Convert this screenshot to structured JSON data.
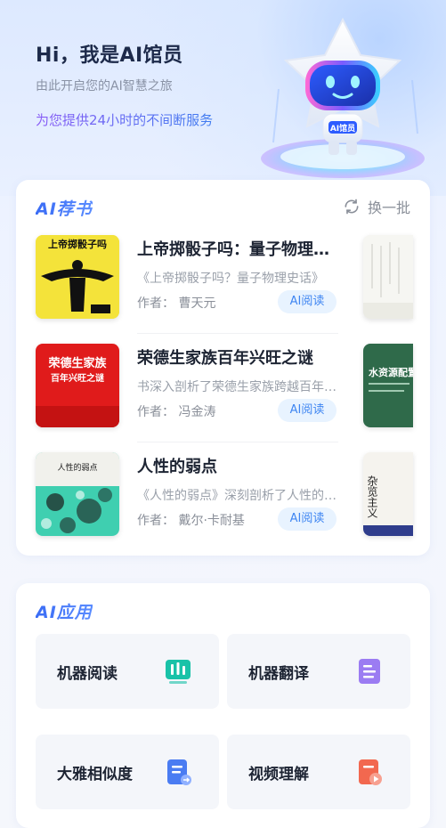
{
  "header": {
    "greeting": "Hi，我是AI馆员",
    "subtitle": "由此开启您的AI智慧之旅",
    "service": "为您提供24小时的不间断服务",
    "mascot_badge": "AI馆员"
  },
  "recommend": {
    "title": "AI荐书",
    "refresh_label": "换一批",
    "read_label": "AI阅读",
    "books": [
      {
        "title": "上帝掷骰子吗：量子物理史话",
        "desc": "《上帝掷骰子吗？量子物理史话》",
        "author": "作者：  曹天元",
        "cover_title": "上帝掷骰子吗"
      },
      {
        "title": "荣德生家族百年兴旺之谜",
        "desc": "书深入剖析了荣德生家族跨越百年的兴旺之谜",
        "author": "作者：  冯金涛",
        "cover_title": "荣德生家族",
        "cover_sub": "百年兴旺之谜"
      },
      {
        "title": "人性的弱点",
        "desc": "《人性的弱点》深刻剖析了人性的弱点",
        "author": "作者：  戴尔·卡耐基",
        "cover_title": "人性的弱点"
      }
    ],
    "peek_covers": [
      {
        "text": ""
      },
      {
        "text": "水资源配置"
      },
      {
        "text": "杂览主义"
      }
    ]
  },
  "apps": {
    "title": "AI应用",
    "items": [
      {
        "label": "机器阅读",
        "icon": "bar-chart-icon",
        "color": "#19c2a8"
      },
      {
        "label": "机器翻译",
        "icon": "document-icon",
        "color": "#9b7cf2"
      },
      {
        "label": "大雅相似度",
        "icon": "compare-document-icon",
        "color": "#4a7cf2"
      },
      {
        "label": "视频理解",
        "icon": "video-document-icon",
        "color": "#f2684f"
      }
    ]
  }
}
